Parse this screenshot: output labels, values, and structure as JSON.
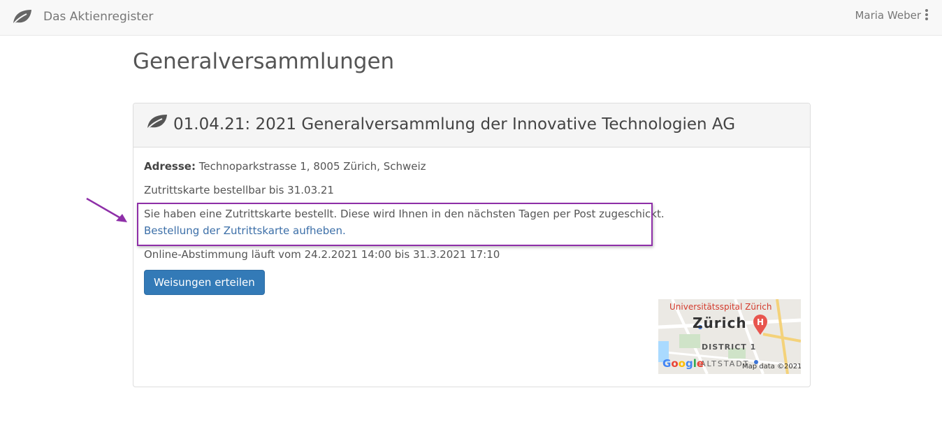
{
  "navbar": {
    "brand_name": "Das Aktienregister",
    "user_name": "Maria Weber",
    "brand_icon": "leaf-icon",
    "menu_icon": "kebab-icon"
  },
  "page": {
    "title": "Generalversammlungen"
  },
  "event": {
    "title": "01.04.21: 2021 Generalversammlung der Innovative Technologien AG",
    "address_label": "Adresse:",
    "address": "Technoparkstrasse 1, 8005 Zürich, Schweiz",
    "ticket_deadline": "Zutrittskarte bestellbar bis 31.03.21",
    "ticket_ordered_notice": "Sie haben eine Zutrittskarte bestellt. Diese wird Ihnen in den nächsten Tagen per Post zugeschickt.",
    "cancel_ticket_link": "Bestellung der Zutrittskarte aufheben.",
    "online_voting": "Online-Abstimmung läuft vom 24.2.2021 14:00 bis 31.3.2021 17:10",
    "instructions_button": "Weisungen erteilen"
  },
  "map": {
    "hospital_label": "Universitätsspital Zürich",
    "city_label": "Zürich",
    "district_label": "DISTRICT 1",
    "altstadt_label": "ALTSTADT",
    "google_logo": "Google",
    "map_credit": "Map data ©2021"
  },
  "colors": {
    "primary": "#337ab7",
    "link": "#3c6fa8",
    "annotation": "#8e2fa8"
  }
}
